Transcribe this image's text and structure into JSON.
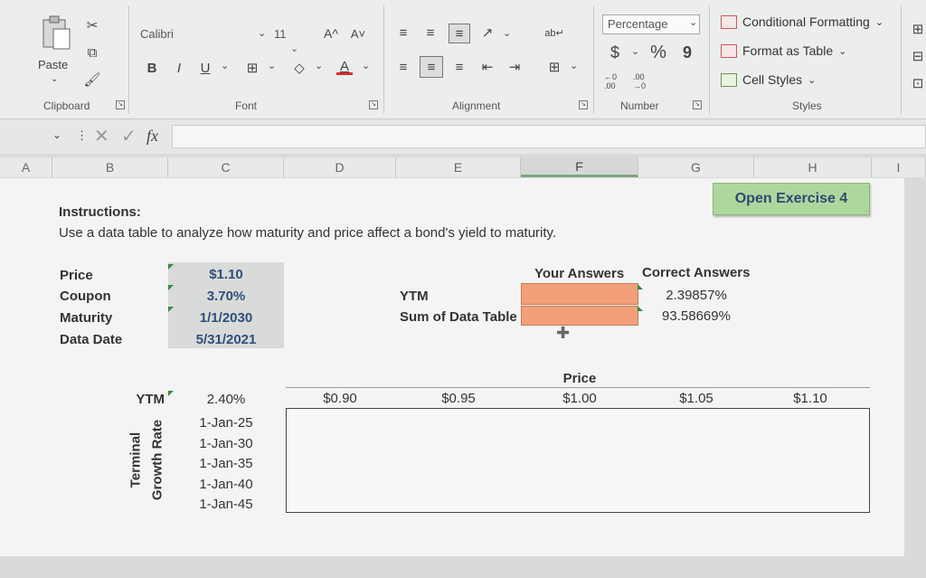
{
  "ribbon": {
    "clipboard": {
      "paste_label": "Paste",
      "group_label": "Clipboard"
    },
    "font": {
      "name": "Calibri",
      "size": "11",
      "bold": "B",
      "italic": "I",
      "underline": "U",
      "grow": "A^",
      "shrink": "A˅",
      "font_color": "A",
      "group_label": "Font"
    },
    "alignment": {
      "group_label": "Alignment"
    },
    "number": {
      "format": "Percentage",
      "currency": "$",
      "percent": "%",
      "comma": "9",
      "inc_decimal": "←0 .00",
      "dec_decimal": ".00 →0",
      "group_label": "Number"
    },
    "styles": {
      "conditional": "Conditional Formatting",
      "format_table": "Format as Table",
      "cell_styles": "Cell Styles",
      "group_label": "Styles"
    }
  },
  "formula_bar": {
    "fx": "fx",
    "value": ""
  },
  "columns": [
    "A",
    "B",
    "C",
    "D",
    "E",
    "F",
    "G",
    "H",
    "I"
  ],
  "sheet": {
    "open_exercise": "Open Exercise 4",
    "instructions_title": "Instructions:",
    "instructions_text": "Use a data table to analyze how maturity and price affect a bond's yield to maturity.",
    "inputs": [
      {
        "label": "Price",
        "value": "$1.10"
      },
      {
        "label": "Coupon",
        "value": "3.70%"
      },
      {
        "label": "Maturity",
        "value": "1/1/2030"
      },
      {
        "label": "Data Date",
        "value": "5/31/2021"
      }
    ],
    "answers": {
      "your_answers": "Your Answers",
      "correct_answers": "Correct Answers",
      "ytm_label": "YTM",
      "sum_label": "Sum of Data Table",
      "ytm_correct": "2.39857%",
      "sum_correct": "93.58669%"
    },
    "table": {
      "price_header": "Price",
      "corner_label": "YTM",
      "corner_value": "2.40%",
      "prices": [
        "$0.90",
        "$0.95",
        "$1.00",
        "$1.05",
        "$1.10"
      ],
      "side_label_1": "Terminal",
      "side_label_2": "Growth Rate",
      "dates": [
        "1-Jan-25",
        "1-Jan-30",
        "1-Jan-35",
        "1-Jan-40",
        "1-Jan-45"
      ]
    }
  }
}
